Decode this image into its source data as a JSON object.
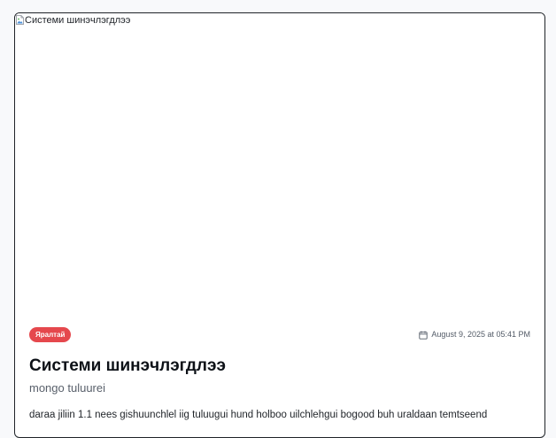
{
  "post": {
    "image_alt": "Системи шинэчлэгдлээ",
    "category_badge": "Яралтай",
    "date": "August 9, 2025 at 05:41 PM",
    "title": "Системи шинэчлэгдлээ",
    "subtitle": "mongo tuluurei",
    "body": "daraa jiliin 1.1 nees gishuunchlel iig tuluugui hund holboo uilchlehgui bogood buh uraldaan temtseend"
  },
  "icons": {
    "broken_image": "broken-image-icon",
    "calendar": "calendar-icon"
  },
  "colors": {
    "badge_bg": "#e5484d",
    "badge_text": "#ffffff",
    "title": "#0d1117",
    "subtitle": "#59606b",
    "date": "#525a66"
  }
}
